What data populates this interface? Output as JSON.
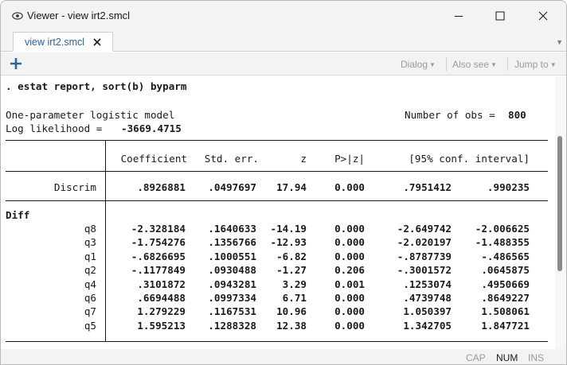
{
  "window": {
    "title": "Viewer - view irt2.smcl",
    "min_glyph": "—",
    "max_glyph": "☐",
    "close_glyph": "✕"
  },
  "tab": {
    "label": "view irt2.smcl"
  },
  "toolbar": {
    "dialog": "Dialog",
    "also_see": "Also see",
    "jump_to": "Jump to"
  },
  "output": {
    "command": ". estat report, sort(b) byparm",
    "model_title": "One-parameter logistic model",
    "obs_label": "Number of obs =",
    "obs_value": "800",
    "loglik_label": "Log likelihood =",
    "loglik_value": "-3669.4715",
    "headers": {
      "coef": "Coefficient",
      "se": "Std. err.",
      "z": "z",
      "p": "P>|z|",
      "ci": "[95% conf. interval]"
    },
    "discrim": {
      "label": "Discrim",
      "coef": ".8926881",
      "se": ".0497697",
      "z": "17.94",
      "p": "0.000",
      "lo": ".7951412",
      "hi": ".990235"
    },
    "diff_label": "Diff",
    "rows": [
      {
        "label": "q8",
        "coef": "-2.328184",
        "se": ".1640633",
        "z": "-14.19",
        "p": "0.000",
        "lo": "-2.649742",
        "hi": "-2.006625"
      },
      {
        "label": "q3",
        "coef": "-1.754276",
        "se": ".1356766",
        "z": "-12.93",
        "p": "0.000",
        "lo": "-2.020197",
        "hi": "-1.488355"
      },
      {
        "label": "q1",
        "coef": "-.6826695",
        "se": ".1000551",
        "z": "-6.82",
        "p": "0.000",
        "lo": "-.8787739",
        "hi": "-.486565"
      },
      {
        "label": "q2",
        "coef": "-.1177849",
        "se": ".0930488",
        "z": "-1.27",
        "p": "0.206",
        "lo": "-.3001572",
        "hi": ".0645875"
      },
      {
        "label": "q4",
        "coef": ".3101872",
        "se": ".0943281",
        "z": "3.29",
        "p": "0.001",
        "lo": ".1253074",
        "hi": ".4950669"
      },
      {
        "label": "q6",
        "coef": ".6694488",
        "se": ".0997334",
        "z": "6.71",
        "p": "0.000",
        "lo": ".4739748",
        "hi": ".8649227"
      },
      {
        "label": "q7",
        "coef": "1.279229",
        "se": ".1167531",
        "z": "10.96",
        "p": "0.000",
        "lo": "1.050397",
        "hi": "1.508061"
      },
      {
        "label": "q5",
        "coef": "1.595213",
        "se": ".1288328",
        "z": "12.38",
        "p": "0.000",
        "lo": "1.342705",
        "hi": "1.847721"
      }
    ]
  },
  "status": {
    "cap": "CAP",
    "num": "NUM",
    "ins": "INS"
  },
  "colors": {
    "accent": "#2b5fb4",
    "chrome": "#f3f3f3",
    "status_active": "#1a1a1a",
    "status_inactive": "#9a9a9a"
  }
}
